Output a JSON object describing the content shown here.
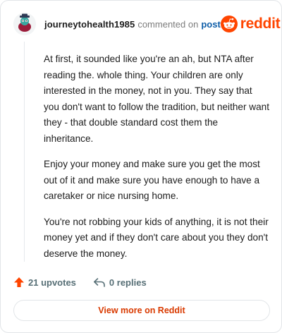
{
  "header": {
    "username": "journeytohealth1985",
    "commented_text": "commented on",
    "post_link": "post",
    "brand": "reddit"
  },
  "comment": {
    "paragraphs": [
      "At first, it sounded like you're an ah, but NTA after reading the. whole thing. Your children are only interested in the money, not in you. They say that you don't want to follow the tradition, but neither want they - that double standard cost them the inheritance.",
      "Enjoy your money and make sure you get the most out of it and make sure you have enough to have a caretaker or nice nursing home.",
      "You're not robbing your kids of anything, it is not their money yet and if they don't care about you they don't deserve the money."
    ]
  },
  "actions": {
    "upvotes": "21 upvotes",
    "replies": "0 replies"
  },
  "footer": {
    "view_more": "View more on Reddit"
  },
  "colors": {
    "accent": "#ff4500",
    "link": "#0f5ea8",
    "cta": "#d93a00"
  }
}
